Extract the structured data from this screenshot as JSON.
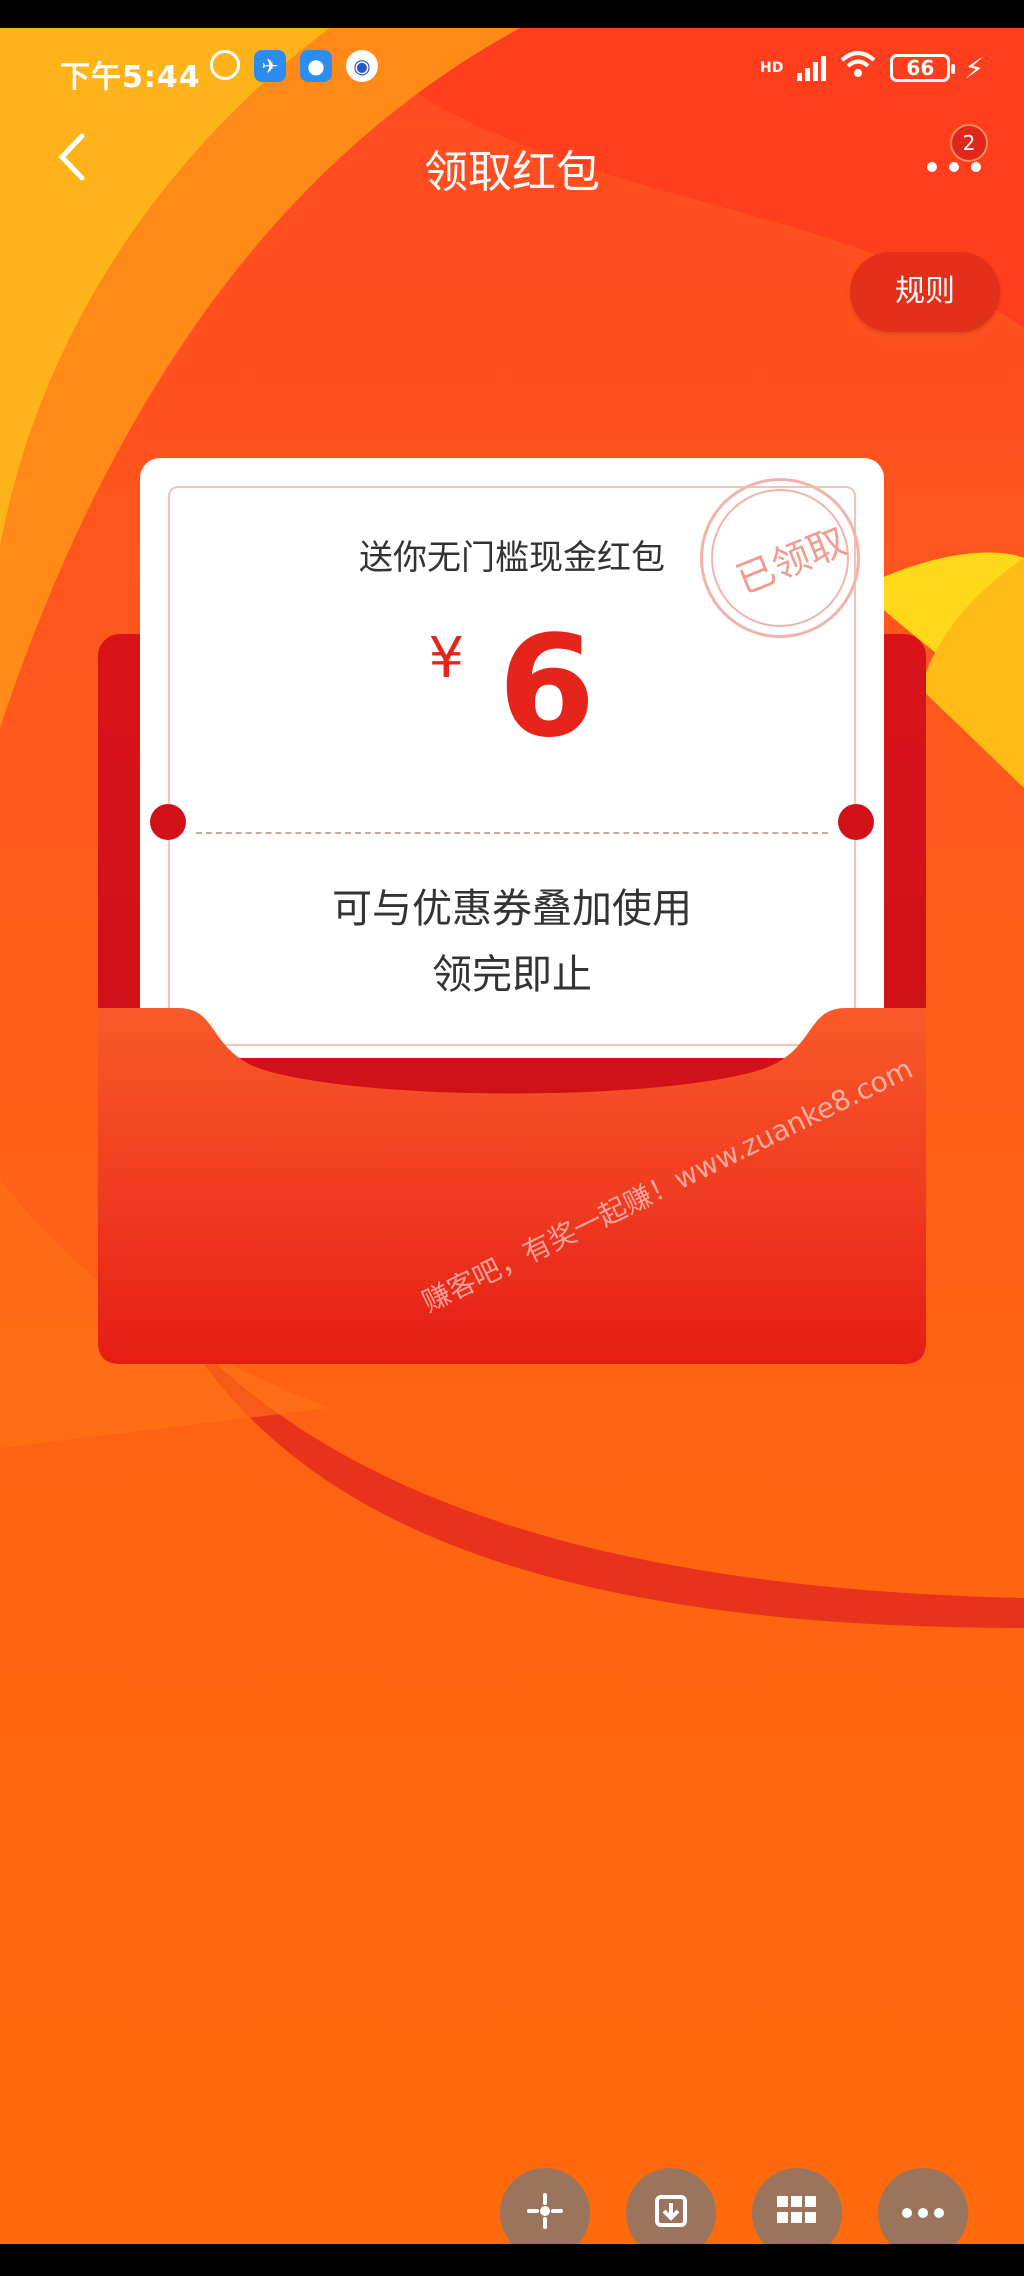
{
  "status_bar": {
    "time": "下午5:44",
    "battery": "66",
    "network": "HD"
  },
  "nav": {
    "title": "领取红包",
    "badge_count": "2"
  },
  "rules_button": "规则",
  "card": {
    "title": "送你无门槛现金红包",
    "currency": "¥",
    "amount": "6",
    "desc_line1": "可与优惠券叠加使用",
    "desc_line2": "领完即止",
    "stamp": "已领取"
  },
  "watermark": "赚客吧，有奖一起赚！www.zuanke8.com",
  "colors": {
    "primary_red": "#e5241b",
    "background_orange": "#ff5a1c",
    "envelope_red": "#d8141a"
  },
  "bottom_actions": [
    {
      "icon": "sparkle-icon"
    },
    {
      "icon": "download-icon"
    },
    {
      "icon": "grid-icon"
    },
    {
      "icon": "more-icon"
    }
  ]
}
